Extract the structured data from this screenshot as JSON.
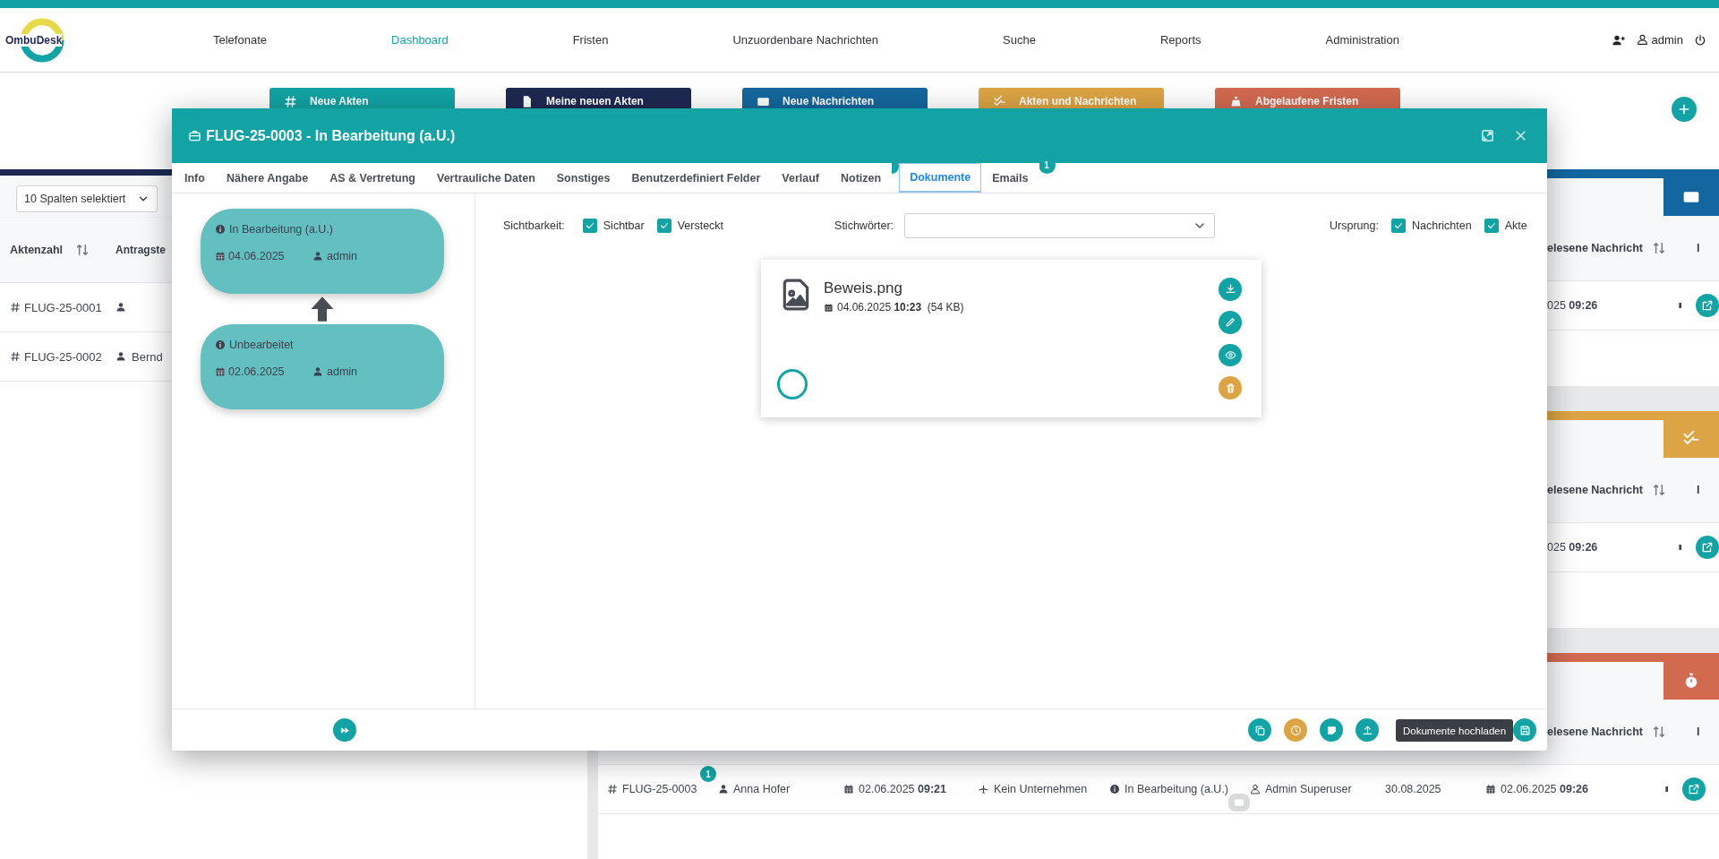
{
  "app": {
    "logo_text": "OmbuDesk",
    "nav": [
      {
        "label": "Telefonate",
        "selected": false
      },
      {
        "label": "Dashboard",
        "selected": true
      },
      {
        "label": "Fristen",
        "selected": false
      },
      {
        "label": "Unzuordenbare Nachrichten",
        "selected": false
      },
      {
        "label": "Suche",
        "selected": false
      },
      {
        "label": "Reports",
        "selected": false
      },
      {
        "label": "Administration",
        "selected": false
      }
    ],
    "user": "admin"
  },
  "summary_cards": [
    {
      "label": "Neue Akten",
      "kind": "hash",
      "color": "#13a3a4"
    },
    {
      "label": "Meine neuen Akten",
      "kind": "file",
      "color": "#1e2952"
    },
    {
      "label": "Neue Nachrichten",
      "kind": "mail",
      "color": "#14679e"
    },
    {
      "label": "Akten und Nachrichten",
      "kind": "checks",
      "color": "#dca444"
    },
    {
      "label": "Abgelaufene Fristen",
      "kind": "bag",
      "color": "#d26a50"
    }
  ],
  "left_panel": {
    "column_filter": "10 Spalten selektiert",
    "columns": [
      "Aktenzahl",
      "Antragste"
    ],
    "rows": [
      {
        "case": "FLUG-25-0001"
      },
      {
        "case": "FLUG-25-0002",
        "applicant": "Bernd"
      }
    ]
  },
  "right_sections": [
    {
      "kind": "mail",
      "color": "#14679e",
      "column_header": "elesene Nachricht",
      "column_header_2": "I",
      "rows": [
        {
          "kind": "partial",
          "date": "025",
          "time": "09:26"
        }
      ]
    },
    {
      "kind": "checks",
      "color": "#dca444",
      "column_header": "elesene Nachricht",
      "column_header_2": "I",
      "rows": [
        {
          "kind": "partial",
          "date": "025",
          "time": "09:26"
        }
      ]
    },
    {
      "kind": "stopwatch",
      "color": "#d26a50",
      "column_header": "elesene Nachricht",
      "column_header_2": "I",
      "rows": [
        {
          "kind": "full",
          "case": "FLUG-25-0003",
          "badge": "1",
          "applicant": "Anna Hofer",
          "created_date": "02.06.2025",
          "created_time": "09:21",
          "company": "Kein Unternehmen",
          "status": "In Bearbeitung (a.U.)",
          "assignee": "Admin Superuser",
          "deadline": "30.08.2025",
          "last_date": "02.06.2025",
          "last_time": "09:26"
        }
      ]
    }
  ],
  "modal": {
    "title": "FLUG-25-0003 - In Bearbeitung (a.U.)",
    "tabs": [
      {
        "label": "Info",
        "selected": false
      },
      {
        "label": "Nähere Angabe",
        "selected": false
      },
      {
        "label": "AS & Vertretung",
        "selected": false
      },
      {
        "label": "Vertrauliche Daten",
        "selected": false
      },
      {
        "label": "Sonstiges",
        "selected": false
      },
      {
        "label": "Benutzerdefiniert Felder",
        "selected": false
      },
      {
        "label": "Verlauf",
        "selected": false
      },
      {
        "label": "Notizen",
        "selected": false,
        "badge_cut": true
      },
      {
        "label": "Dokumente",
        "selected": true
      },
      {
        "label": "Emails",
        "selected": false,
        "badge": "1"
      }
    ],
    "timeline": [
      {
        "status": "In Bearbeitung (a.U.)",
        "date": "04.06.2025",
        "user": "admin"
      },
      {
        "status": "Unbearbeitet",
        "date": "02.06.2025",
        "user": "admin"
      }
    ],
    "filters": {
      "visibility_label": "Sichtbarkeit:",
      "visibility": [
        {
          "label": "Sichtbar",
          "checked": true
        },
        {
          "label": "Versteckt",
          "checked": true
        }
      ],
      "keywords_label": "Stichwörter:",
      "origin_label": "Ursprung:",
      "origin": [
        {
          "label": "Nachrichten",
          "checked": true
        },
        {
          "label": "Akte",
          "checked": true
        }
      ]
    },
    "document": {
      "name": "Beweis.png",
      "date": "04.06.2025",
      "time": "10:23",
      "size": "(54 KB)",
      "actions": [
        {
          "kind": "download",
          "color": "#13a3a4"
        },
        {
          "kind": "pencil",
          "color": "#13a3a4"
        },
        {
          "kind": "eye",
          "color": "#13a3a4"
        },
        {
          "kind": "trash",
          "color": "#dca444"
        }
      ]
    },
    "footer_buttons": [
      {
        "kind": "copy",
        "color": "#13a3a4"
      },
      {
        "kind": "clock",
        "color": "#dca444"
      },
      {
        "kind": "note",
        "color": "#13a3a4"
      },
      {
        "kind": "upload",
        "color": "#13a3a4"
      },
      {
        "kind": "save",
        "color": "#13a3a4"
      }
    ],
    "tooltip": "Dokumente hochladen"
  }
}
